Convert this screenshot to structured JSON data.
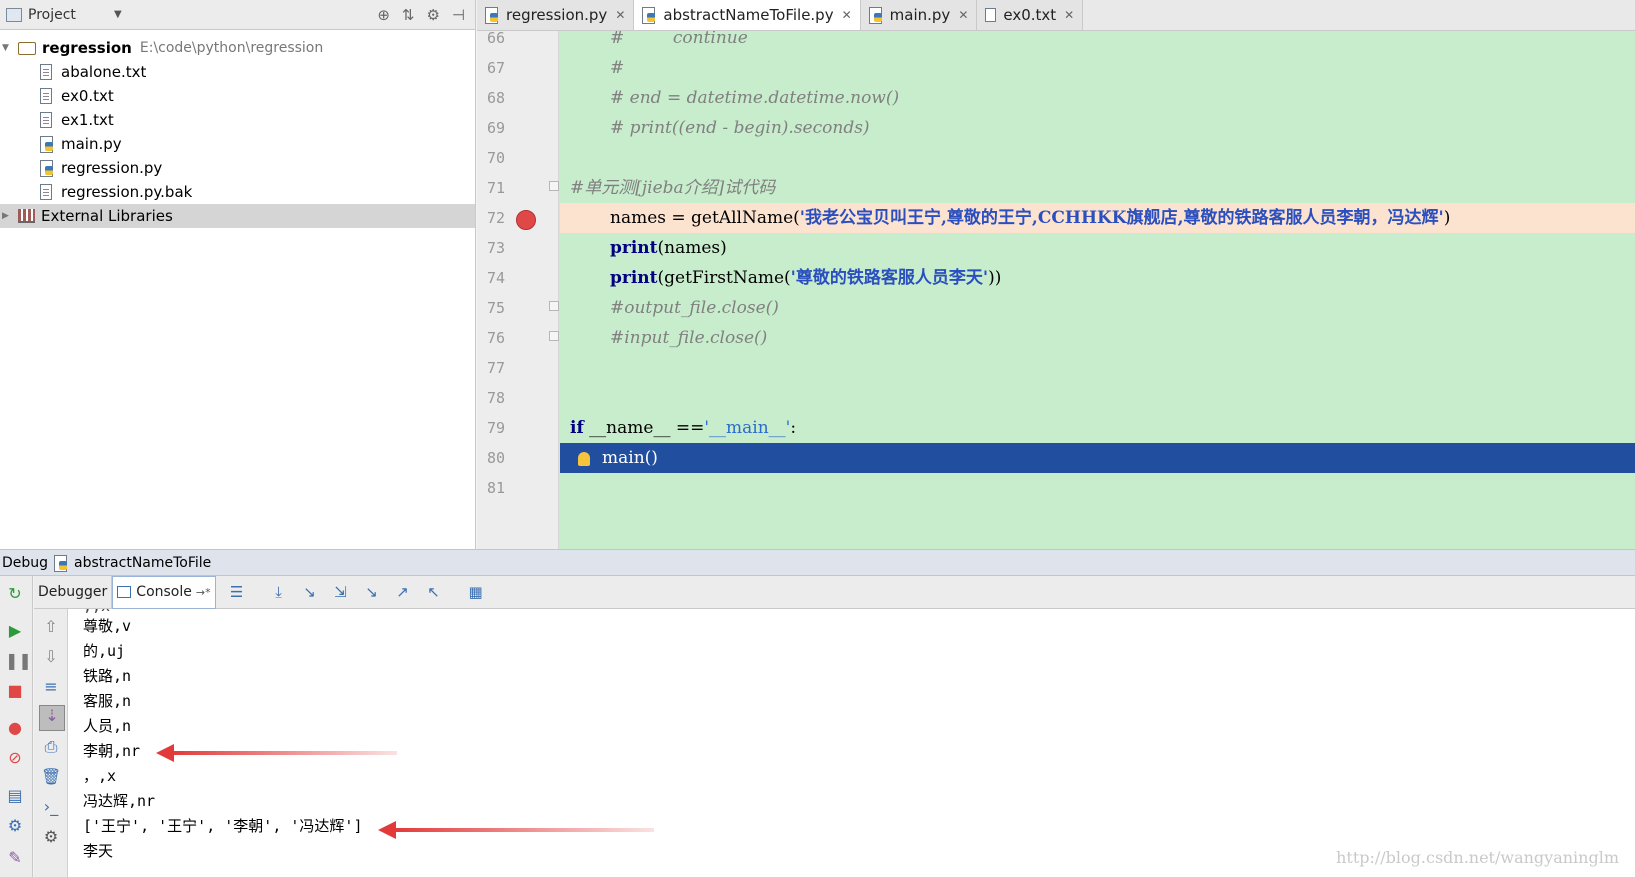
{
  "project": {
    "header_label": "Project",
    "root": {
      "name": "regression",
      "path": "E:\\code\\python\\regression"
    },
    "files": [
      {
        "name": "abalone.txt",
        "type": "txt"
      },
      {
        "name": "ex0.txt",
        "type": "txt"
      },
      {
        "name": "ex1.txt",
        "type": "txt"
      },
      {
        "name": "main.py",
        "type": "py"
      },
      {
        "name": "regression.py",
        "type": "py"
      },
      {
        "name": "regression.py.bak",
        "type": "txt"
      }
    ],
    "external": "External Libraries"
  },
  "tabs": [
    {
      "label": "regression.py",
      "type": "py",
      "active": false
    },
    {
      "label": "abstractNameToFile.py",
      "type": "py",
      "active": true
    },
    {
      "label": "main.py",
      "type": "py",
      "active": false
    },
    {
      "label": "ex0.txt",
      "type": "txt",
      "active": false
    }
  ],
  "editor": {
    "line_numbers": [
      "66",
      "67",
      "68",
      "69",
      "70",
      "71",
      "72",
      "73",
      "74",
      "75",
      "76",
      "77",
      "78",
      "79",
      "80",
      "81"
    ],
    "lines": {
      "l66_comment": "#         continue",
      "l67_comment": "#",
      "l68_comment": "# end = datetime.datetime.now()",
      "l69_comment": "# print((end - begin).seconds)",
      "l71_comment": "#单元测[jieba介绍]试代码",
      "l72_prefix": "names = getAllName(",
      "l72_string": "'我老公宝贝叫王宁,尊敬的王宁,CCHHKK旗舰店,尊敬的铁路客服人员李朝，冯达辉'",
      "l72_suffix": ")",
      "l73_kw": "print",
      "l73_rest": "(names)",
      "l74_kw": "print",
      "l74_mid": "(getFirstName(",
      "l74_string": "'尊敬的铁路客服人员李天'",
      "l74_suffix": "))",
      "l75_comment": "#output_file.close()",
      "l76_comment": "#input_file.close()",
      "l79_kw": "if",
      "l79_mid": " __name__ ==",
      "l79_string": "'__main__'",
      "l79_suffix": ":",
      "l80_code": "main()"
    }
  },
  "debug": {
    "title": "Debug",
    "config": "abstractNameToFile",
    "tab_debugger": "Debugger",
    "tab_console": "Console",
    "console_lines": [
      "尊敬,v",
      "的,uj",
      "铁路,n",
      "客服,n",
      "人员,n",
      "李朝,nr",
      "，,x",
      "冯达辉,nr",
      "['王宁', '王宁', '李朝', '冯达辉']",
      "李天"
    ]
  },
  "watermark": "http://blog.csdn.net/wangyaninglm",
  "colors": {
    "editor_bg": "#c7edcc",
    "current_line": "#214e9e",
    "breakpoint": "#e04848",
    "annotation_arrow": "#e23a3a"
  }
}
